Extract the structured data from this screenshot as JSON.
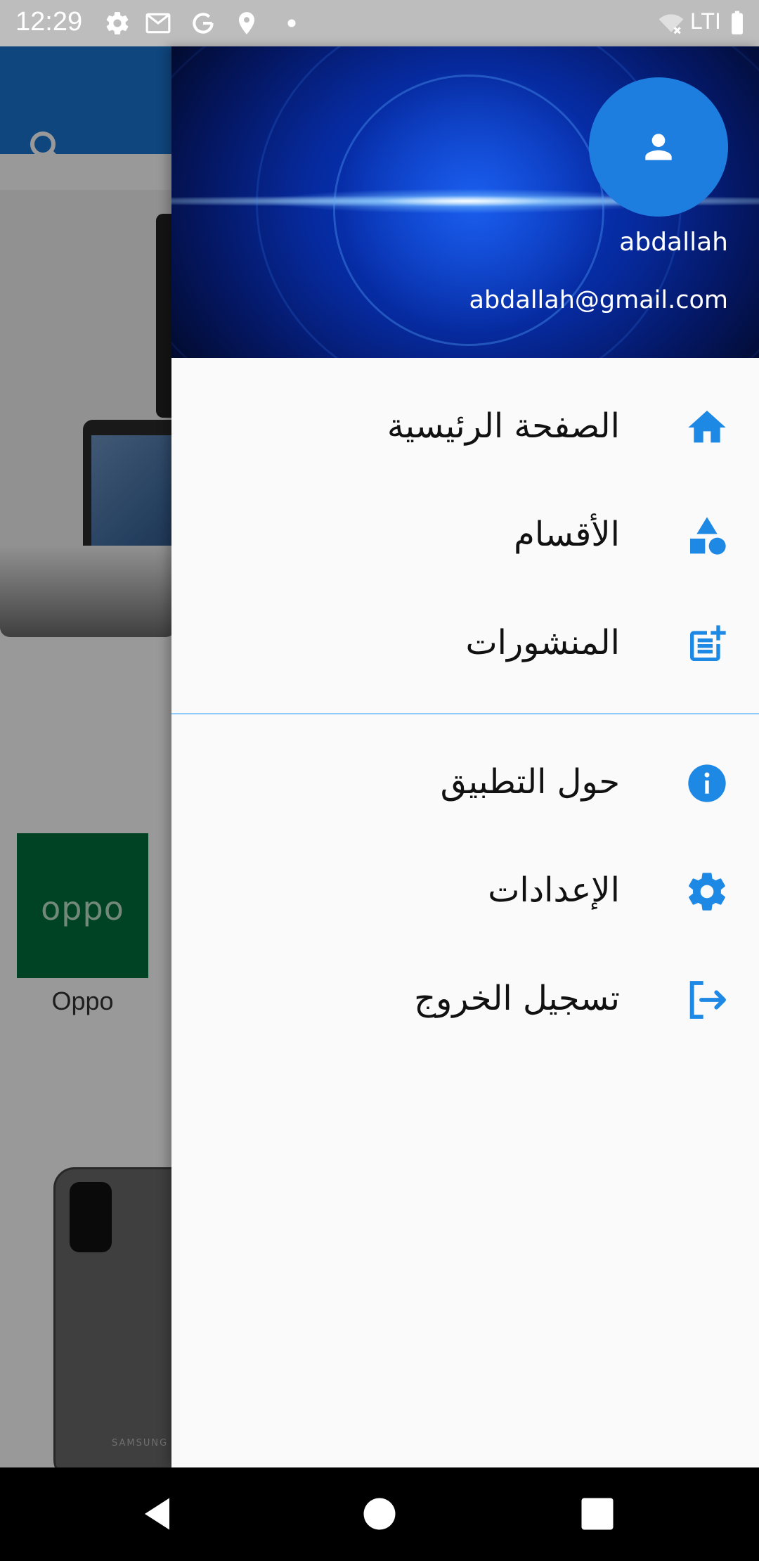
{
  "status_bar": {
    "time": "12:29",
    "network": "LTI"
  },
  "background": {
    "brand_card_logo": "oppo",
    "brand_card_caption": "Oppo",
    "phone_brand_text": "SAMSUNG"
  },
  "drawer": {
    "user": {
      "name": "abdallah",
      "email": "abdallah@gmail.com"
    },
    "items": [
      {
        "label": "الصفحة الرئيسية",
        "icon": "home-icon"
      },
      {
        "label": "الأقسام",
        "icon": "category-icon"
      },
      {
        "label": "المنشورات",
        "icon": "post-add-icon"
      },
      {
        "label": "حول التطبيق",
        "icon": "info-icon"
      },
      {
        "label": "الإعدادات",
        "icon": "settings-icon"
      },
      {
        "label": "تسجيل الخروج",
        "icon": "logout-icon"
      }
    ]
  },
  "colors": {
    "accent": "#1e88e5",
    "divider": "#90caf9",
    "avatar_bg": "#1e7ee0"
  }
}
